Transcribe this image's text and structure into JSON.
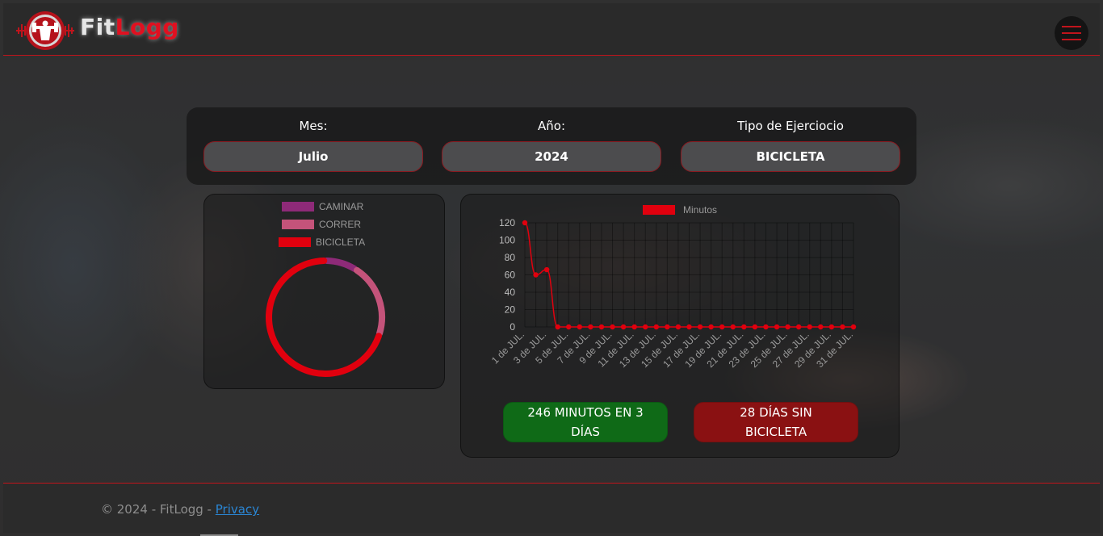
{
  "brand": {
    "name_part1": "Fit",
    "name_part2": "Logg",
    "accent": "#e01020"
  },
  "nav": {
    "menu_icon": "hamburger-icon"
  },
  "filters": {
    "month": {
      "label": "Mes:",
      "value": "Julio"
    },
    "year": {
      "label": "Año:",
      "value": "2024"
    },
    "exercise_type": {
      "label": "Tipo de Ejerciocio",
      "value": "BICICLETA"
    }
  },
  "chart_data": [
    {
      "type": "pie",
      "variant": "doughnut",
      "legend": "top",
      "labels": [
        "CAMINAR",
        "CORRER",
        "BICICLETA"
      ],
      "colors": [
        "#8e2a78",
        "#c4537a",
        "#e1000e"
      ],
      "values": [
        9,
        21,
        70
      ]
    },
    {
      "type": "line",
      "legend": "top",
      "series": [
        {
          "name": "Minutos",
          "color": "#e1000e",
          "values": [
            120,
            60,
            66,
            0,
            0,
            0,
            0,
            0,
            0,
            0,
            0,
            0,
            0,
            0,
            0,
            0,
            0,
            0,
            0,
            0,
            0,
            0,
            0,
            0,
            0,
            0,
            0,
            0,
            0,
            0,
            0
          ]
        }
      ],
      "x": [
        "1 de JUL.",
        "2 de JUL.",
        "3 de JUL.",
        "4 de JUL.",
        "5 de JUL.",
        "6 de JUL.",
        "7 de JUL.",
        "8 de JUL.",
        "9 de JUL.",
        "10 de JUL.",
        "11 de JUL.",
        "12 de JUL.",
        "13 de JUL.",
        "14 de JUL.",
        "15 de JUL.",
        "16 de JUL.",
        "17 de JUL.",
        "18 de JUL.",
        "19 de JUL.",
        "20 de JUL.",
        "21 de JUL.",
        "22 de JUL.",
        "23 de JUL.",
        "24 de JUL.",
        "25 de JUL.",
        "26 de JUL.",
        "27 de JUL.",
        "28 de JUL.",
        "29 de JUL.",
        "30 de JUL.",
        "31 de JUL."
      ],
      "x_tick_labels": [
        "1 de JUL.",
        "3 de JUL.",
        "5 de JUL.",
        "7 de JUL.",
        "9 de JUL.",
        "11 de JUL.",
        "13 de JUL.",
        "15 de JUL.",
        "17 de JUL.",
        "19 de JUL.",
        "21 de JUL.",
        "23 de JUL.",
        "25 de JUL.",
        "27 de JUL.",
        "29 de JUL.",
        "31 de JUL."
      ],
      "y_ticks": [
        0,
        20,
        40,
        60,
        80,
        100,
        120
      ],
      "ylim": [
        0,
        120
      ],
      "grid": true
    }
  ],
  "stats": {
    "minutes": "246 MINUTOS EN 3 DÍAS",
    "days_without": "28 DÍAS SIN BICICLETA"
  },
  "footer": {
    "copyright": "© 2024 - FitLogg - ",
    "privacy_link": "Privacy"
  }
}
